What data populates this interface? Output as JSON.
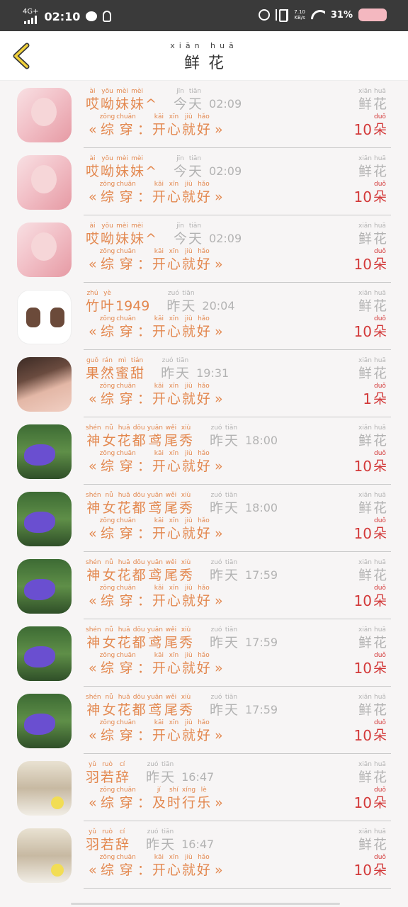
{
  "status": {
    "network": "4G+",
    "time": "02:10",
    "speed_value": "7.10",
    "speed_unit": "KB/s",
    "battery": "31%"
  },
  "header": {
    "title_pinyin": [
      "xiān",
      "huā"
    ],
    "title": "鲜花"
  },
  "list": {
    "flower_pinyin": [
      "xiān",
      "huā"
    ],
    "flower_label": [
      "鲜",
      "花"
    ],
    "unit_pinyin": "duǒ",
    "unit_label": "朵",
    "rows": [
      {
        "avatar": "av-pink",
        "name": [
          [
            "ài",
            "哎"
          ],
          [
            "yōu",
            "呦"
          ],
          [
            "mèi",
            "妹"
          ],
          [
            "mèi",
            "妹"
          ]
        ],
        "name_suffix": "^",
        "day": [
          [
            "jīn",
            "今"
          ],
          [
            "tiān",
            "天"
          ]
        ],
        "time": "02:09",
        "message": [
          [
            "zōng",
            "综"
          ],
          [
            "chuān",
            "穿"
          ],
          [
            "",
            "："
          ],
          [
            "kāi",
            "开"
          ],
          [
            "xīn",
            "心"
          ],
          [
            "jiù",
            "就"
          ],
          [
            "hǎo",
            "好"
          ]
        ],
        "count": "10"
      },
      {
        "avatar": "av-pink",
        "name": [
          [
            "ài",
            "哎"
          ],
          [
            "yōu",
            "呦"
          ],
          [
            "mèi",
            "妹"
          ],
          [
            "mèi",
            "妹"
          ]
        ],
        "name_suffix": "^",
        "day": [
          [
            "jīn",
            "今"
          ],
          [
            "tiān",
            "天"
          ]
        ],
        "time": "02:09",
        "message": [
          [
            "zōng",
            "综"
          ],
          [
            "chuān",
            "穿"
          ],
          [
            "",
            "："
          ],
          [
            "kāi",
            "开"
          ],
          [
            "xīn",
            "心"
          ],
          [
            "jiù",
            "就"
          ],
          [
            "hǎo",
            "好"
          ]
        ],
        "count": "10"
      },
      {
        "avatar": "av-pink",
        "name": [
          [
            "ài",
            "哎"
          ],
          [
            "yōu",
            "呦"
          ],
          [
            "mèi",
            "妹"
          ],
          [
            "mèi",
            "妹"
          ]
        ],
        "name_suffix": "^",
        "day": [
          [
            "jīn",
            "今"
          ],
          [
            "tiān",
            "天"
          ]
        ],
        "time": "02:09",
        "message": [
          [
            "zōng",
            "综"
          ],
          [
            "chuān",
            "穿"
          ],
          [
            "",
            "："
          ],
          [
            "kāi",
            "开"
          ],
          [
            "xīn",
            "心"
          ],
          [
            "jiù",
            "就"
          ],
          [
            "hǎo",
            "好"
          ]
        ],
        "count": "10"
      },
      {
        "avatar": "av-cartoon",
        "name": [
          [
            "zhú",
            "竹"
          ],
          [
            "yè",
            "叶"
          ]
        ],
        "name_suffix": "1949",
        "day": [
          [
            "zuó",
            "昨"
          ],
          [
            "tiān",
            "天"
          ]
        ],
        "time": "20:04",
        "message": [
          [
            "zōng",
            "综"
          ],
          [
            "chuān",
            "穿"
          ],
          [
            "",
            "："
          ],
          [
            "kāi",
            "开"
          ],
          [
            "xīn",
            "心"
          ],
          [
            "jiù",
            "就"
          ],
          [
            "hǎo",
            "好"
          ]
        ],
        "count": "10"
      },
      {
        "avatar": "av-girl",
        "name": [
          [
            "guǒ",
            "果"
          ],
          [
            "rán",
            "然"
          ],
          [
            "mì",
            "蜜"
          ],
          [
            "tián",
            "甜"
          ]
        ],
        "name_suffix": "",
        "day": [
          [
            "zuó",
            "昨"
          ],
          [
            "tiān",
            "天"
          ]
        ],
        "time": "19:31",
        "message": [
          [
            "zōng",
            "综"
          ],
          [
            "chuān",
            "穿"
          ],
          [
            "",
            "："
          ],
          [
            "kāi",
            "开"
          ],
          [
            "xīn",
            "心"
          ],
          [
            "jiù",
            "就"
          ],
          [
            "hǎo",
            "好"
          ]
        ],
        "count": "1"
      },
      {
        "avatar": "av-flower",
        "name": [
          [
            "shén",
            "神"
          ],
          [
            "nǚ",
            "女"
          ],
          [
            "huā",
            "花"
          ],
          [
            "dōu",
            "都"
          ],
          [
            "yuān",
            "鸢"
          ],
          [
            "wěi",
            "尾"
          ],
          [
            "xiù",
            "秀"
          ]
        ],
        "name_suffix": "",
        "day": [
          [
            "zuó",
            "昨"
          ],
          [
            "tiān",
            "天"
          ]
        ],
        "time": "18:00",
        "message": [
          [
            "zōng",
            "综"
          ],
          [
            "chuān",
            "穿"
          ],
          [
            "",
            "："
          ],
          [
            "kāi",
            "开"
          ],
          [
            "xīn",
            "心"
          ],
          [
            "jiù",
            "就"
          ],
          [
            "hǎo",
            "好"
          ]
        ],
        "count": "10"
      },
      {
        "avatar": "av-flower",
        "name": [
          [
            "shén",
            "神"
          ],
          [
            "nǚ",
            "女"
          ],
          [
            "huā",
            "花"
          ],
          [
            "dōu",
            "都"
          ],
          [
            "yuān",
            "鸢"
          ],
          [
            "wěi",
            "尾"
          ],
          [
            "xiù",
            "秀"
          ]
        ],
        "name_suffix": "",
        "day": [
          [
            "zuó",
            "昨"
          ],
          [
            "tiān",
            "天"
          ]
        ],
        "time": "18:00",
        "message": [
          [
            "zōng",
            "综"
          ],
          [
            "chuān",
            "穿"
          ],
          [
            "",
            "："
          ],
          [
            "kāi",
            "开"
          ],
          [
            "xīn",
            "心"
          ],
          [
            "jiù",
            "就"
          ],
          [
            "hǎo",
            "好"
          ]
        ],
        "count": "10"
      },
      {
        "avatar": "av-flower",
        "name": [
          [
            "shén",
            "神"
          ],
          [
            "nǚ",
            "女"
          ],
          [
            "huā",
            "花"
          ],
          [
            "dōu",
            "都"
          ],
          [
            "yuān",
            "鸢"
          ],
          [
            "wěi",
            "尾"
          ],
          [
            "xiù",
            "秀"
          ]
        ],
        "name_suffix": "",
        "day": [
          [
            "zuó",
            "昨"
          ],
          [
            "tiān",
            "天"
          ]
        ],
        "time": "17:59",
        "message": [
          [
            "zōng",
            "综"
          ],
          [
            "chuān",
            "穿"
          ],
          [
            "",
            "："
          ],
          [
            "kāi",
            "开"
          ],
          [
            "xīn",
            "心"
          ],
          [
            "jiù",
            "就"
          ],
          [
            "hǎo",
            "好"
          ]
        ],
        "count": "10"
      },
      {
        "avatar": "av-flower",
        "name": [
          [
            "shén",
            "神"
          ],
          [
            "nǚ",
            "女"
          ],
          [
            "huā",
            "花"
          ],
          [
            "dōu",
            "都"
          ],
          [
            "yuān",
            "鸢"
          ],
          [
            "wěi",
            "尾"
          ],
          [
            "xiù",
            "秀"
          ]
        ],
        "name_suffix": "",
        "day": [
          [
            "zuó",
            "昨"
          ],
          [
            "tiān",
            "天"
          ]
        ],
        "time": "17:59",
        "message": [
          [
            "zōng",
            "综"
          ],
          [
            "chuān",
            "穿"
          ],
          [
            "",
            "："
          ],
          [
            "kāi",
            "开"
          ],
          [
            "xīn",
            "心"
          ],
          [
            "jiù",
            "就"
          ],
          [
            "hǎo",
            "好"
          ]
        ],
        "count": "10"
      },
      {
        "avatar": "av-flower",
        "name": [
          [
            "shén",
            "神"
          ],
          [
            "nǚ",
            "女"
          ],
          [
            "huā",
            "花"
          ],
          [
            "dōu",
            "都"
          ],
          [
            "yuān",
            "鸢"
          ],
          [
            "wěi",
            "尾"
          ],
          [
            "xiù",
            "秀"
          ]
        ],
        "name_suffix": "",
        "day": [
          [
            "zuó",
            "昨"
          ],
          [
            "tiān",
            "天"
          ]
        ],
        "time": "17:59",
        "message": [
          [
            "zōng",
            "综"
          ],
          [
            "chuān",
            "穿"
          ],
          [
            "",
            "："
          ],
          [
            "kāi",
            "开"
          ],
          [
            "xīn",
            "心"
          ],
          [
            "jiù",
            "就"
          ],
          [
            "hǎo",
            "好"
          ]
        ],
        "count": "10"
      },
      {
        "avatar": "av-anime",
        "name": [
          [
            "yǔ",
            "羽"
          ],
          [
            "ruò",
            "若"
          ],
          [
            "cí",
            "辞"
          ]
        ],
        "name_suffix": "",
        "day": [
          [
            "zuó",
            "昨"
          ],
          [
            "tiān",
            "天"
          ]
        ],
        "time": "16:47",
        "message": [
          [
            "zōng",
            "综"
          ],
          [
            "chuān",
            "穿"
          ],
          [
            "",
            "："
          ],
          [
            "jí",
            "及"
          ],
          [
            "shí",
            "时"
          ],
          [
            "xíng",
            "行"
          ],
          [
            "lè",
            "乐"
          ]
        ],
        "count": "10"
      },
      {
        "avatar": "av-anime",
        "name": [
          [
            "yǔ",
            "羽"
          ],
          [
            "ruò",
            "若"
          ],
          [
            "cí",
            "辞"
          ]
        ],
        "name_suffix": "",
        "day": [
          [
            "zuó",
            "昨"
          ],
          [
            "tiān",
            "天"
          ]
        ],
        "time": "16:47",
        "message": [
          [
            "zōng",
            "综"
          ],
          [
            "chuān",
            "穿"
          ],
          [
            "",
            "："
          ],
          [
            "kāi",
            "开"
          ],
          [
            "xīn",
            "心"
          ],
          [
            "jiù",
            "就"
          ],
          [
            "hǎo",
            "好"
          ]
        ],
        "count": "10"
      }
    ]
  },
  "colors": {
    "accent_orange": "#e3884f",
    "count_red": "#d33a3a",
    "muted_gray": "#b3b3b3"
  }
}
